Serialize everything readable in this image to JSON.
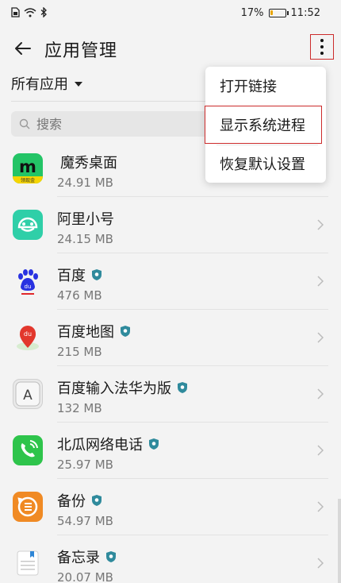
{
  "status_bar": {
    "battery_text": "17%",
    "battery_level": 0.17,
    "time": "11:52"
  },
  "header": {
    "title": "应用管理",
    "back_icon": "back-arrow-icon",
    "more_icon": "more-vert-icon"
  },
  "filter": {
    "label": "所有应用"
  },
  "search": {
    "placeholder": "搜索"
  },
  "menu": {
    "items": [
      {
        "label": "打开链接"
      },
      {
        "label": "显示系统进程"
      },
      {
        "label": "恢复默认设置"
      }
    ]
  },
  "apps": [
    {
      "name": "魔秀桌面",
      "size": "24.91 MB",
      "icon_text": "m",
      "badge_text": "领现金",
      "verified": false
    },
    {
      "name": "阿里小号",
      "size": "24.15 MB",
      "verified": false
    },
    {
      "name": "百度",
      "size": "476 MB",
      "icon_text": "du",
      "verified": true
    },
    {
      "name": "百度地图",
      "size": "215 MB",
      "icon_text": "du",
      "verified": true
    },
    {
      "name": "百度输入法华为版",
      "size": "132 MB",
      "icon_text": "A",
      "verified": true
    },
    {
      "name": "北瓜网络电话",
      "size": "25.97 MB",
      "verified": true
    },
    {
      "name": "备份",
      "size": "54.97 MB",
      "verified": true
    },
    {
      "name": "备忘录",
      "size": "20.07 MB",
      "verified": true
    }
  ],
  "colors": {
    "highlight": "#cc2b2b",
    "verified_badge": "#2f8a9c"
  }
}
